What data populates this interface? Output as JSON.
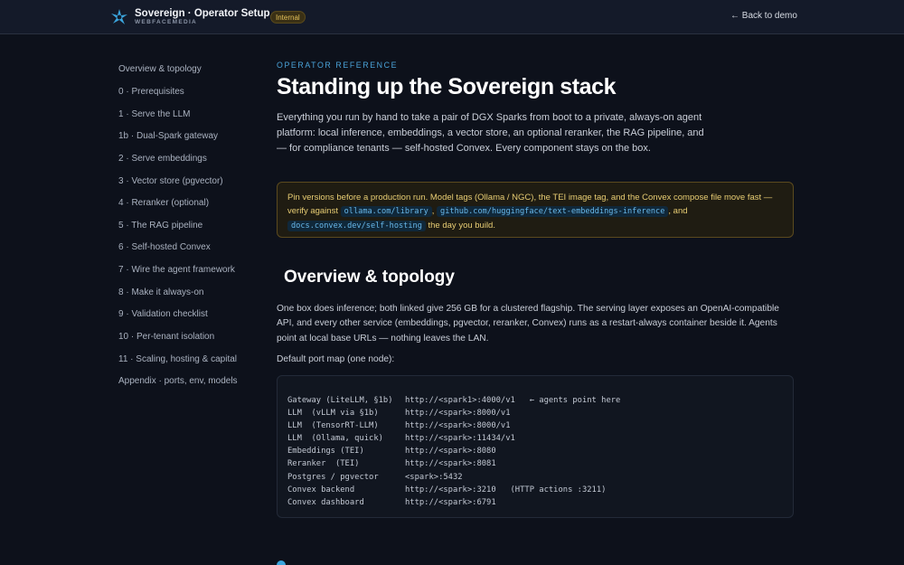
{
  "header": {
    "title": "Sovereign · Operator Setup",
    "subtitle": "WEBFACEMEDIA",
    "badge": "Internal",
    "back_link": "← Back to demo"
  },
  "sidebar": {
    "items": [
      {
        "label": "Overview & topology"
      },
      {
        "label": "0 · Prerequisites"
      },
      {
        "label": "1 · Serve the LLM"
      },
      {
        "label": "1b · Dual-Spark gateway"
      },
      {
        "label": "2 · Serve embeddings"
      },
      {
        "label": "3 · Vector store (pgvector)"
      },
      {
        "label": "4 · Reranker (optional)"
      },
      {
        "label": "5 · The RAG pipeline"
      },
      {
        "label": "6 · Self-hosted Convex"
      },
      {
        "label": "7 · Wire the agent framework"
      },
      {
        "label": "8 · Make it always-on"
      },
      {
        "label": "9 · Validation checklist"
      },
      {
        "label": "10 · Per-tenant isolation"
      },
      {
        "label": "11 · Scaling, hosting & capital"
      },
      {
        "label": "Appendix · ports, env, models"
      }
    ]
  },
  "main": {
    "eyebrow": "OPERATOR REFERENCE",
    "title": "Standing up the Sovereign stack",
    "intro": "Everything you run by hand to take a pair of DGX Sparks from boot to a private, always-on agent platform: local inference, embeddings, a vector store, an optional reranker, the RAG pipeline, and — for compliance tenants — self-hosted Convex. Every component stays on the box.",
    "callout": {
      "text_1": "Pin versions before a production run. Model tags (Ollama / NGC), the TEI image tag, and the Convex compose file move fast — verify against ",
      "code_1": "ollama.com/library",
      "text_2": ", ",
      "code_2": "github.com/huggingface/text-embeddings-inference",
      "text_3": ", and ",
      "code_3": "docs.convex.dev/self-hosting",
      "text_4": " the day you build."
    },
    "section_title": "Overview & topology",
    "section_para": "One box does inference; both linked give 256 GB for a clustered flagship. The serving layer exposes an OpenAI-compatible API, and every other service (embeddings, pgvector, reranker, Convex) runs as a restart-always container beside it. Agents point at local base URLs — nothing leaves the LAN.",
    "port_map_label": "Default port map (one node):",
    "port_map": [
      {
        "service": "Gateway (LiteLLM, §1b)",
        "address": "http://<spark1>:4000/v1   ← agents point here"
      },
      {
        "service": "LLM  (vLLM via §1b)",
        "address": "http://<spark>:8000/v1"
      },
      {
        "service": "LLM  (TensorRT-LLM)",
        "address": "http://<spark>:8000/v1"
      },
      {
        "service": "LLM  (Ollama, quick)",
        "address": "http://<spark>:11434/v1"
      },
      {
        "service": "Embeddings (TEI)",
        "address": "http://<spark>:8080"
      },
      {
        "service": "Reranker  (TEI)",
        "address": "http://<spark>:8081"
      },
      {
        "service": "Postgres / pgvector",
        "address": "<spark>:5432"
      },
      {
        "service": "Convex backend",
        "address": "http://<spark>:3210   (HTTP actions :3211)"
      },
      {
        "service": "Convex dashboard",
        "address": "http://<spark>:6791"
      }
    ]
  },
  "colors": {
    "background": "#0d111b",
    "header": "#141a29",
    "accent": "#4aa3d9",
    "callout_text": "#e8cd73",
    "badge": "#e5c25a"
  }
}
